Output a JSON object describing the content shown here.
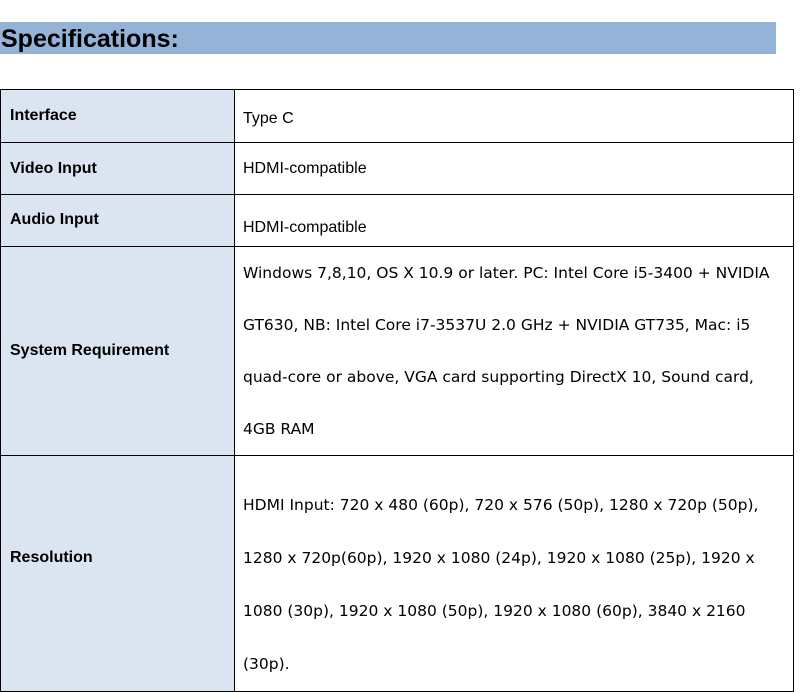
{
  "heading": "Specifications:",
  "rows": [
    {
      "label": "Interface",
      "value": "Type C"
    },
    {
      "label": "Video Input",
      "value": "HDMI-compatible"
    },
    {
      "label": "Audio Input",
      "value": "HDMI-compatible"
    },
    {
      "label": "System Requirement",
      "value": "Windows 7,8,10, OS X 10.9 or later. PC: Intel Core i5-3400 + NVIDIA GT630, NB: Intel Core i7-3537U 2.0 GHz + NVIDIA GT735, Mac: i5 quad-core or above, VGA card supporting DirectX 10, Sound card, 4GB RAM"
    },
    {
      "label": "Resolution",
      "value": "HDMI Input: 720 x 480 (60p), 720 x 576 (50p), 1280 x 720p (50p), 1280 x 720p(60p), 1920 x 1080 (24p), 1920 x 1080 (25p), 1920 x 1080 (30p), 1920 x 1080 (50p), 1920 x 1080 (60p), 3840 x 2160 (30p)."
    }
  ],
  "colors": {
    "heading_bar": "#95b3d7",
    "label_cell_bg": "#dbe5f1",
    "border": "#000000"
  }
}
